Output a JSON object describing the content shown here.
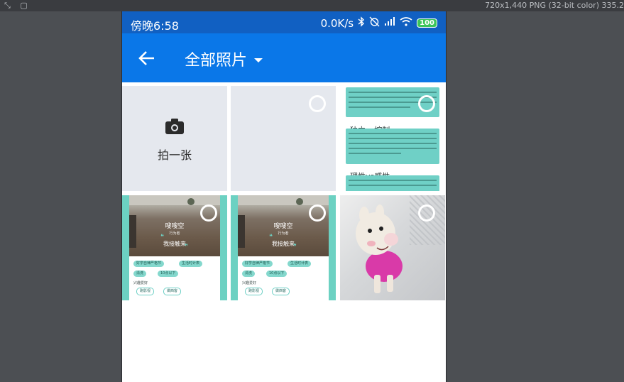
{
  "host_window": {
    "file_info": "720x1,440 PNG (32-bit color) 335.2"
  },
  "status_bar": {
    "time": "傍晚6:58",
    "network_speed": "0.0K/s",
    "battery_level": "100",
    "icons": [
      "bluetooth-icon",
      "alarm-off-icon",
      "cellular-signal-icon",
      "wifi-icon",
      "battery-icon"
    ]
  },
  "app_bar": {
    "title": "全部照片",
    "back_icon": "arrow-left-icon",
    "dropdown_icon": "caret-down-icon",
    "color": "#0a77e8"
  },
  "grid": {
    "camera_tile": {
      "icon": "camera-icon",
      "label": "拍一张"
    },
    "doc_tile": {
      "heading_1": "独立vs控制",
      "heading_2": "理性vs感性"
    },
    "profile_tile": {
      "name": "嗖嗖空",
      "subtitle": "行为者",
      "quote": "我接触来",
      "chips": [
        "好学自律严格节",
        "生活时计表",
        "清洗",
        "10点以下"
      ],
      "section_title": "兴趣爱好",
      "interest_chips": [
        "跑影视",
        "做西客"
      ]
    }
  },
  "colors": {
    "status_bar": "#1160c2",
    "accent_teal": "#6fd0c6",
    "tile_bg": "#e5e8ee"
  }
}
